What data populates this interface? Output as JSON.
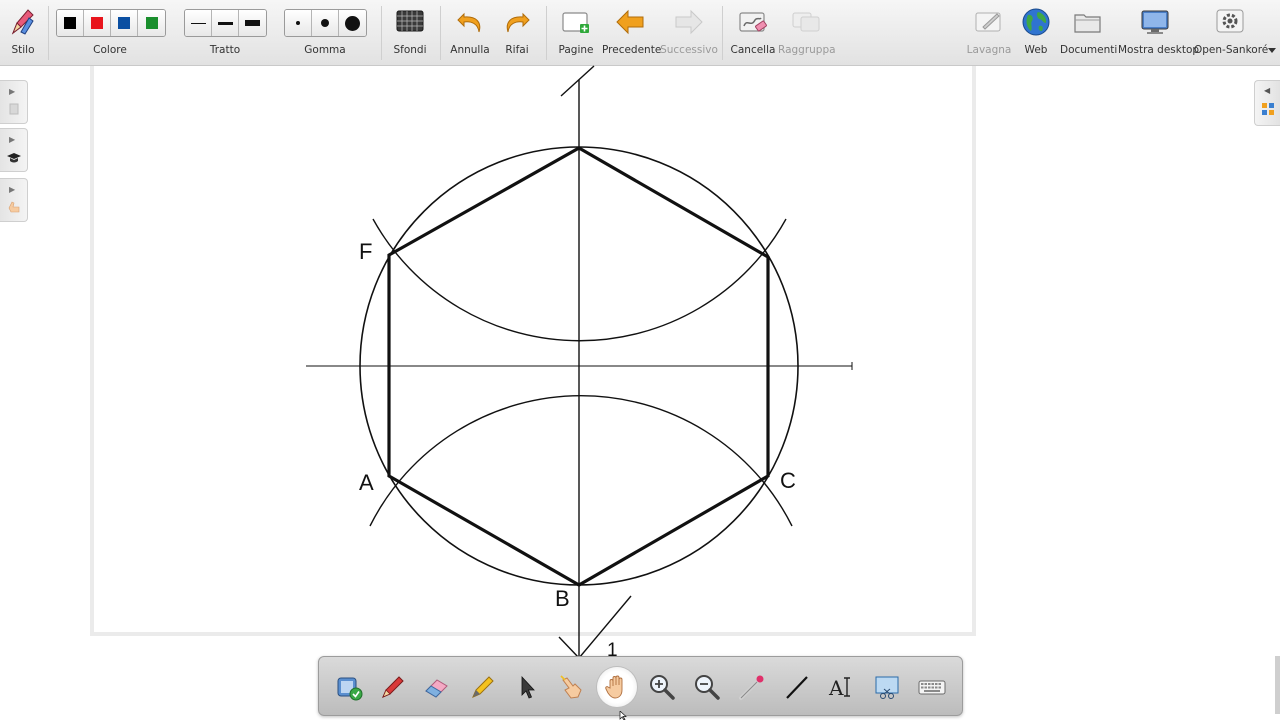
{
  "top_toolbar": {
    "stylus": {
      "label": "Stilo"
    },
    "color": {
      "label": "Colore",
      "swatches": [
        "#000000",
        "#e8141c",
        "#0b4fa2",
        "#1a8f2d"
      ]
    },
    "stroke": {
      "label": "Tratto"
    },
    "eraser": {
      "label": "Gomma"
    },
    "backgrounds": {
      "label": "Sfondi"
    },
    "undo": {
      "label": "Annulla"
    },
    "redo": {
      "label": "Rifai"
    },
    "pages": {
      "label": "Pagine"
    },
    "previous": {
      "label": "Precedente"
    },
    "next": {
      "label": "Successivo",
      "disabled": true
    },
    "clear": {
      "label": "Cancella"
    },
    "group": {
      "label": "Raggruppa",
      "disabled": true
    },
    "board": {
      "label": "Lavagna",
      "disabled": true
    },
    "web": {
      "label": "Web"
    },
    "documents": {
      "label": "Documenti"
    },
    "show_desktop": {
      "label": "Mostra desktop"
    },
    "open_sankore": {
      "label": "Open-Sankoré"
    }
  },
  "drawing": {
    "labels": {
      "F": "F",
      "A": "A",
      "C": "C",
      "B": "B",
      "one": "1"
    }
  },
  "colors": {
    "accent_orange": "#f0a01e",
    "ink": "#111111"
  },
  "bottom_toolbar": {
    "tools": [
      {
        "name": "interactor-tool",
        "icon": "palette-icon"
      },
      {
        "name": "pen-tool",
        "icon": "pen-icon"
      },
      {
        "name": "eraser-tool",
        "icon": "eraser-icon"
      },
      {
        "name": "highlighter-tool",
        "icon": "highlighter-icon"
      },
      {
        "name": "select-tool",
        "icon": "arrow-cursor-icon"
      },
      {
        "name": "play-tool",
        "icon": "pointing-hand-icon"
      },
      {
        "name": "hand-tool",
        "icon": "hand-icon",
        "active": true
      },
      {
        "name": "zoom-in-tool",
        "icon": "zoom-in-icon"
      },
      {
        "name": "zoom-out-tool",
        "icon": "zoom-out-icon"
      },
      {
        "name": "laser-pointer-tool",
        "icon": "laser-pointer-icon"
      },
      {
        "name": "line-tool",
        "icon": "line-icon"
      },
      {
        "name": "text-tool",
        "icon": "text-icon"
      },
      {
        "name": "capture-tool",
        "icon": "capture-icon"
      },
      {
        "name": "keyboard-tool",
        "icon": "keyboard-icon"
      }
    ]
  }
}
